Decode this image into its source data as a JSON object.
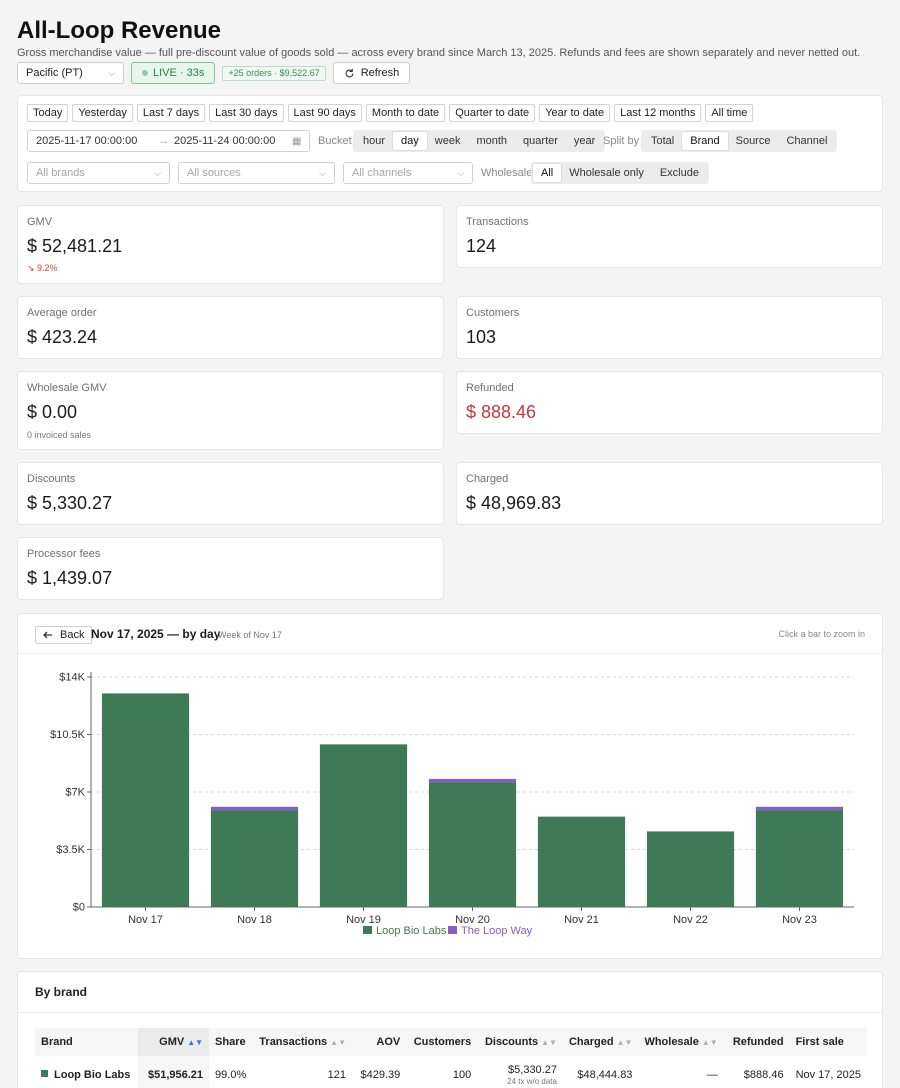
{
  "header": {
    "title": "All-Loop Revenue",
    "subtitle": "Gross merchandise value — full pre-discount value of goods sold — across every brand since March 13, 2025. Refunds and fees are shown separately and never netted out.",
    "timezone": "Pacific (PT)",
    "live": "LIVE · 33s",
    "orders_badge": "+25 orders · $9,522.67",
    "refresh": "Refresh"
  },
  "filters": {
    "ranges": [
      "Today",
      "Yesterday",
      "Last 7 days",
      "Last 30 days",
      "Last 90 days",
      "Month to date",
      "Quarter to date",
      "Year to date",
      "Last 12 months",
      "All time"
    ],
    "date_from": "2025-11-17 00:00:00",
    "date_to": "2025-11-24 00:00:00",
    "bucket_label": "Bucket",
    "buckets": [
      "hour",
      "day",
      "week",
      "month",
      "quarter",
      "year"
    ],
    "bucket_selected": "day",
    "split_label": "Split by",
    "splits": [
      "Total",
      "Brand",
      "Source",
      "Channel"
    ],
    "split_selected": "Brand",
    "brands_placeholder": "All brands",
    "sources_placeholder": "All sources",
    "channels_placeholder": "All channels",
    "wholesale_label": "Wholesale",
    "wholesale_opts": [
      "All",
      "Wholesale only",
      "Exclude"
    ],
    "wholesale_selected": "All"
  },
  "metrics": {
    "gmv": {
      "label": "GMV",
      "value": "$ 52,481.21",
      "delta": "↘ 9.2%"
    },
    "transactions": {
      "label": "Transactions",
      "value": "124"
    },
    "avg_order": {
      "label": "Average order",
      "value": "$ 423.24"
    },
    "customers": {
      "label": "Customers",
      "value": "103"
    },
    "wholesale_gmv": {
      "label": "Wholesale GMV",
      "value": "$ 0.00",
      "sub": "0 invoiced sales"
    },
    "refunded": {
      "label": "Refunded",
      "value": "$ 888.46"
    },
    "discounts": {
      "label": "Discounts",
      "value": "$ 5,330.27"
    },
    "charged": {
      "label": "Charged",
      "value": "$ 48,969.83"
    },
    "processor_fees": {
      "label": "Processor fees",
      "value": "$ 1,439.07"
    }
  },
  "chart": {
    "back": "Back",
    "title": "Nov 17, 2025 — by day",
    "week": "Week of Nov 17",
    "hint": "Click a bar to zoom in"
  },
  "chart_data": {
    "type": "bar",
    "stacked": true,
    "categories": [
      "Nov 17",
      "Nov 18",
      "Nov 19",
      "Nov 20",
      "Nov 21",
      "Nov 22",
      "Nov 23"
    ],
    "series": [
      {
        "name": "Loop Bio Labs",
        "color": "#3d7a55",
        "values": [
          13000,
          5900,
          9900,
          7600,
          5500,
          4600,
          5900
        ]
      },
      {
        "name": "The Loop Way",
        "color": "#8a5cc7",
        "values": [
          0,
          200,
          0,
          200,
          0,
          0,
          200
        ]
      }
    ],
    "y_ticks": [
      "$0",
      "$3.5K",
      "$7K",
      "$10.5K",
      "$14K"
    ],
    "ylim": [
      0,
      14000
    ],
    "grid": true,
    "legend": "bottom"
  },
  "brand_table": {
    "title": "By brand",
    "columns": [
      "Brand",
      "GMV",
      "Share",
      "Transactions",
      "AOV",
      "Customers",
      "Discounts",
      "Charged",
      "Wholesale",
      "Refunded",
      "First sale"
    ],
    "rows": [
      {
        "brand": "Loop Bio Labs",
        "gmv": "$51,956.21",
        "share": "99.0%",
        "transactions": "121",
        "aov": "$429.39",
        "customers": "100",
        "discounts": "$5,330.27",
        "discounts_note": "24 tx w/o data",
        "charged": "$48,444.83",
        "wholesale": "—",
        "refunded": "$888.46",
        "first_sale": "Nov 17, 2025"
      }
    ]
  }
}
